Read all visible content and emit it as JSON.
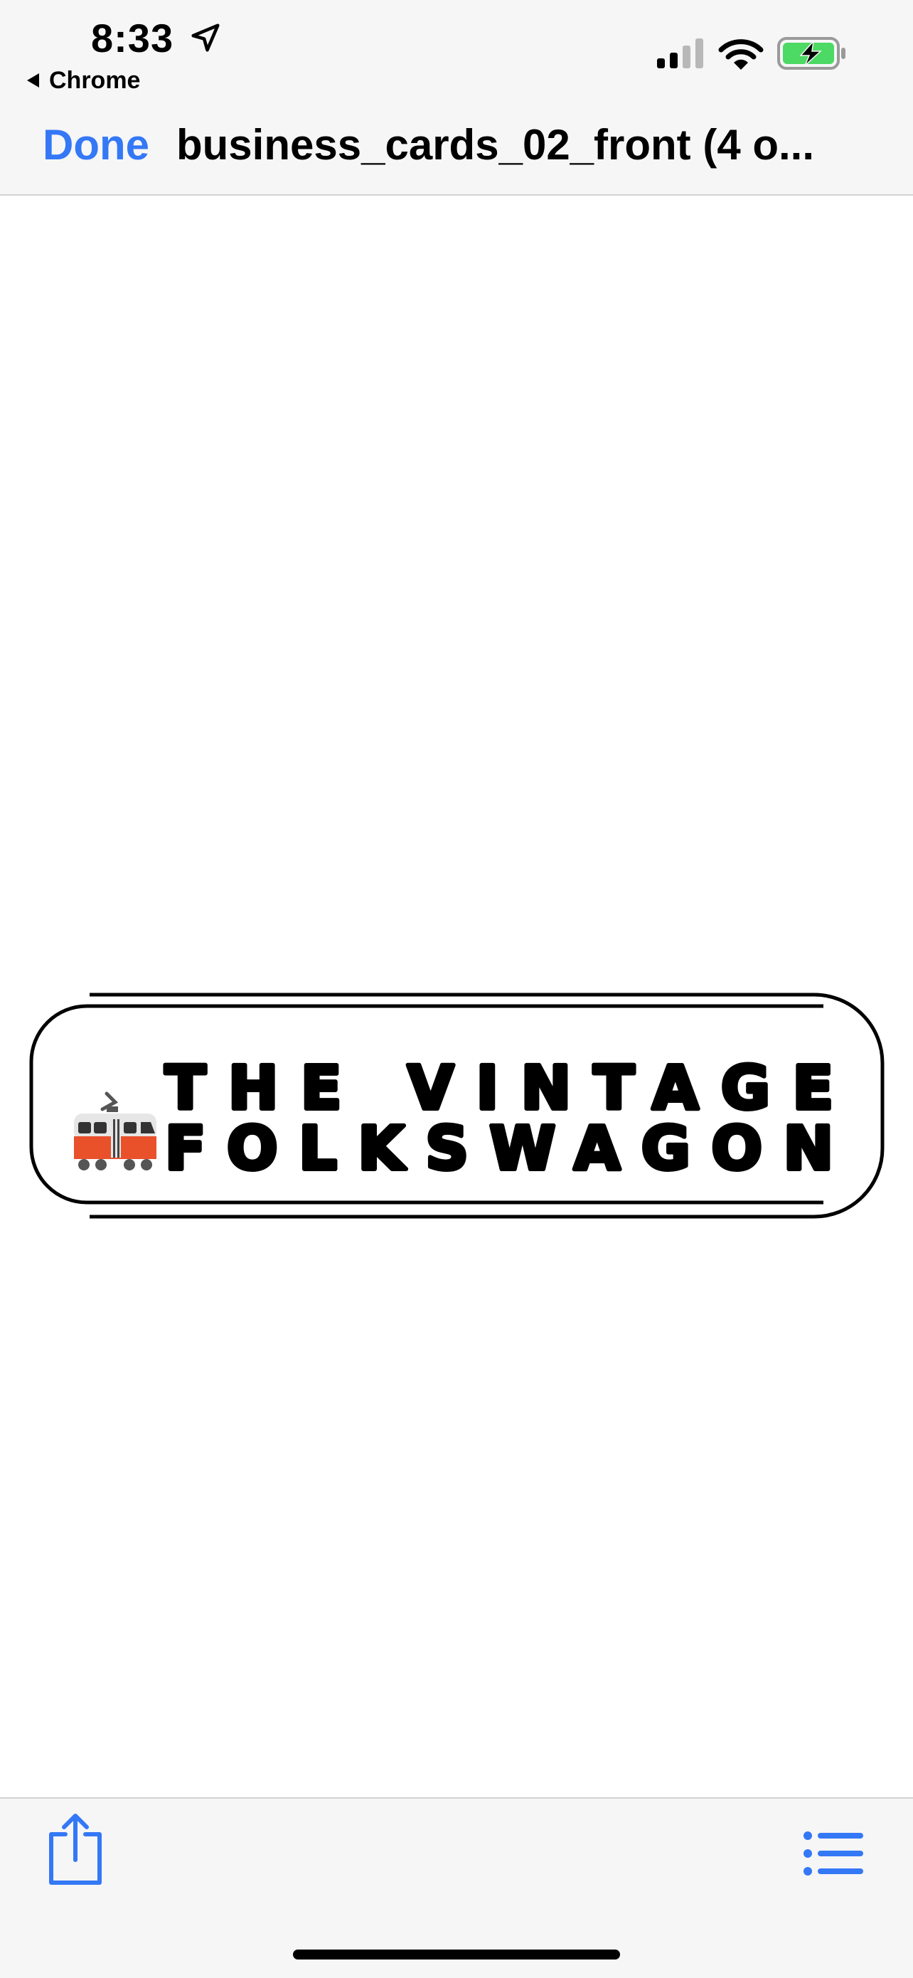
{
  "status_bar": {
    "time": "8:33",
    "back_app": "Chrome",
    "icons": [
      "location-arrow-icon",
      "cellular-signal-icon",
      "wifi-icon",
      "battery-charging-icon"
    ]
  },
  "nav_bar": {
    "done_label": "Done",
    "title": "business_cards_02_front (4 o..."
  },
  "card": {
    "line1": "THE VINTAGE",
    "line2": "FOLKSWAGON",
    "logo_icon": "tram-icon"
  },
  "toolbar": {
    "share_icon": "share-icon",
    "list_icon": "list-icon"
  },
  "colors": {
    "accent": "#3478f6",
    "battery": "#4cd964",
    "tram_red": "#e8512a"
  }
}
